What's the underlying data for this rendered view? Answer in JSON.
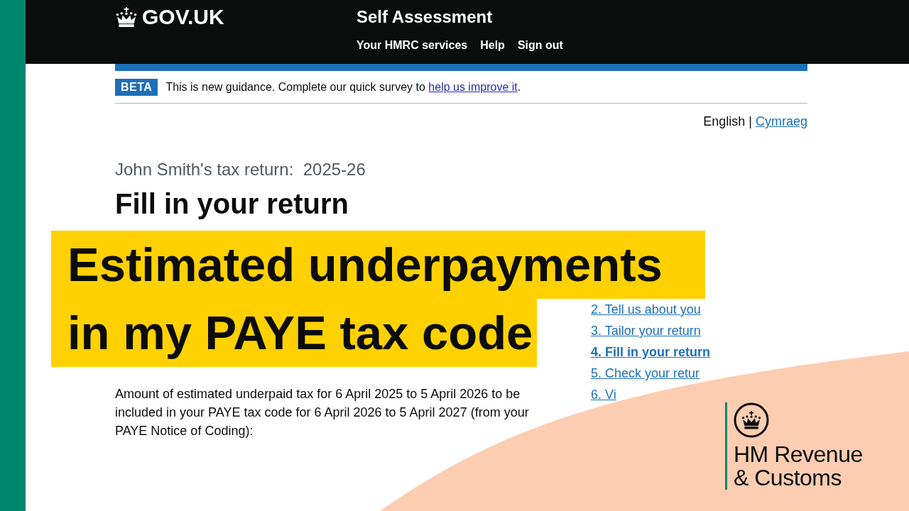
{
  "header": {
    "logo": "GOV.UK",
    "service_name": "Self Assessment",
    "nav": [
      "Your HMRC services",
      "Help",
      "Sign out"
    ]
  },
  "phase_banner": {
    "tag": "BETA",
    "text": "This is new guidance. Complete our quick survey to",
    "link": "help us improve it",
    "end": "."
  },
  "language_toggle": {
    "current": "English",
    "separator": "|",
    "other": "Cymraeg"
  },
  "caption": "John Smith's tax return:  2025-26",
  "heading": "Fill in your return",
  "task_list": [
    {
      "label": "2. Tell us about you",
      "selected": false
    },
    {
      "label": "3. Tailor your return",
      "selected": false
    },
    {
      "label": "4. Fill in your return",
      "selected": true
    },
    {
      "label": "5. Check your retur",
      "selected": false
    },
    {
      "label": "6. Vi",
      "selected": false
    }
  ],
  "body_text": "Amount of estimated underpaid tax for 6 April 2025 to 5 April 2026 to be included in your PAYE tax code for 6 April 2026 to 5 April 2027 (from your PAYE Notice of Coding):",
  "video_title": {
    "lines": [
      "Estimated underpayments",
      "in my PAYE tax code"
    ]
  },
  "hmrc_logo": {
    "lines": [
      "HM Revenue",
      "& Customs"
    ]
  }
}
